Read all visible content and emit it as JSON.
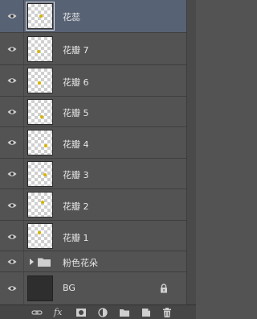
{
  "layers": [
    {
      "name": "花蕊",
      "type": "layer",
      "selected": true,
      "visible": true
    },
    {
      "name": "花瓣 7",
      "type": "layer",
      "selected": false,
      "visible": true
    },
    {
      "name": "花瓣 6",
      "type": "layer",
      "selected": false,
      "visible": true
    },
    {
      "name": "花瓣 5",
      "type": "layer",
      "selected": false,
      "visible": true
    },
    {
      "name": "花瓣 4",
      "type": "layer",
      "selected": false,
      "visible": true
    },
    {
      "name": "花瓣 3",
      "type": "layer",
      "selected": false,
      "visible": true
    },
    {
      "name": "花瓣 2",
      "type": "layer",
      "selected": false,
      "visible": true
    },
    {
      "name": "花瓣 1",
      "type": "layer",
      "selected": false,
      "visible": true
    },
    {
      "name": "粉色花朵",
      "type": "group",
      "collapsed": true,
      "visible": true
    },
    {
      "name": "BG",
      "type": "background",
      "locked": true,
      "visible": true
    }
  ],
  "footer": {
    "fx_label": "fx",
    "icons": [
      "link-icon",
      "fx-icon",
      "add-mask-icon",
      "adjustment-layer-icon",
      "new-group-icon",
      "new-layer-icon",
      "trash-icon"
    ]
  },
  "colors": {
    "panel_bg": "#535353",
    "selected_row": "#586275",
    "thumb_content": "#d8b400"
  }
}
